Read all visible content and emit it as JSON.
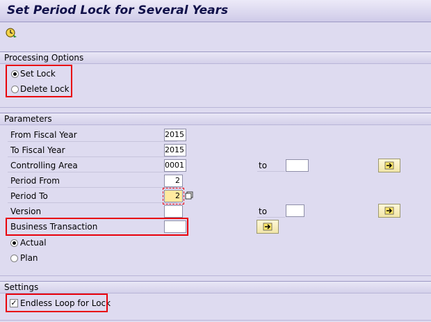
{
  "window": {
    "title": "Set Period Lock for Several Years"
  },
  "toolbar": {
    "execute_icon": "execute-icon"
  },
  "processing_options": {
    "header": "Processing Options",
    "set_lock": {
      "label": "Set Lock",
      "selected": true
    },
    "delete_lock": {
      "label": "Delete Lock",
      "selected": false
    }
  },
  "parameters": {
    "header": "Parameters",
    "from_fiscal_year": {
      "label": "From Fiscal Year",
      "value": "2015"
    },
    "to_fiscal_year": {
      "label": "To Fiscal Year",
      "value": "2015"
    },
    "controlling_area": {
      "label": "Controlling Area",
      "value": "0001",
      "to_label": "to",
      "to_value": ""
    },
    "period_from": {
      "label": "Period From",
      "value": "2"
    },
    "period_to": {
      "label": "Period To",
      "value": "2"
    },
    "version": {
      "label": "Version",
      "value": "",
      "to_label": "to",
      "to_value": ""
    },
    "business_transaction": {
      "label": "Business Transaction",
      "value": ""
    },
    "actual": {
      "label": "Actual",
      "selected": true
    },
    "plan": {
      "label": "Plan",
      "selected": false
    }
  },
  "settings": {
    "header": "Settings",
    "endless_loop": {
      "label": "Endless Loop for Lock",
      "checked": true
    }
  },
  "colors": {
    "highlight_box": "#e8000b",
    "background": "#dedbf0",
    "required_field": "#ffeaa0"
  }
}
